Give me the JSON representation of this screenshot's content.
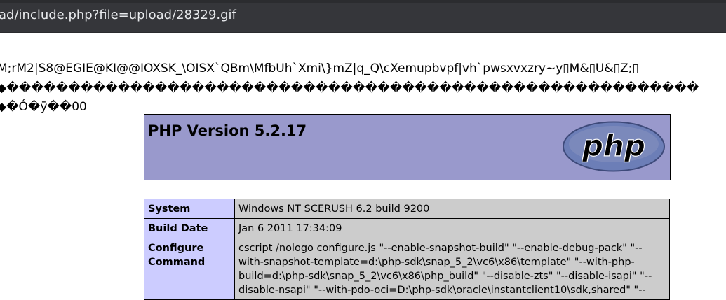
{
  "browser": {
    "url": "ad/include.php?file=upload/28329.gif"
  },
  "garbage": {
    "line1": "M;rM2|S8@EGIE@KI@@IOXSK_\\OISX`QBm\\MfbUh`Xmi\\}mZ|q_Q\\cXemupbvpf|vh`pwsxvxzry~y▯M&▯U&▯Z;▯",
    "line2": "◆��������������������������������������������������������",
    "line3": "◆�Ó�ȳ��00"
  },
  "phpinfo": {
    "title": "PHP Version 5.2.17",
    "logo_text": "php",
    "rows": [
      {
        "key": "System",
        "value": "Windows NT SCERUSH 6.2 build 9200"
      },
      {
        "key": "Build Date",
        "value": "Jan 6 2011 17:34:09"
      },
      {
        "key": "Configure Command",
        "value": "cscript /nologo configure.js \"--enable-snapshot-build\" \"--enable-debug-pack\" \"--with-snapshot-template=d:\\php-sdk\\snap_5_2\\vc6\\x86\\template\" \"--with-php-build=d:\\php-sdk\\snap_5_2\\vc6\\x86\\php_build\" \"--disable-zts\" \"--disable-isapi\" \"--disable-nsapi\" \"--with-pdo-oci=D:\\php-sdk\\oracle\\instantclient10\\sdk,shared\" \"--"
      }
    ]
  },
  "colors": {
    "header_bg": "#9999cc",
    "key_bg": "#ccccff",
    "value_bg": "#cccccc",
    "address_bar_bg": "#35363a"
  }
}
